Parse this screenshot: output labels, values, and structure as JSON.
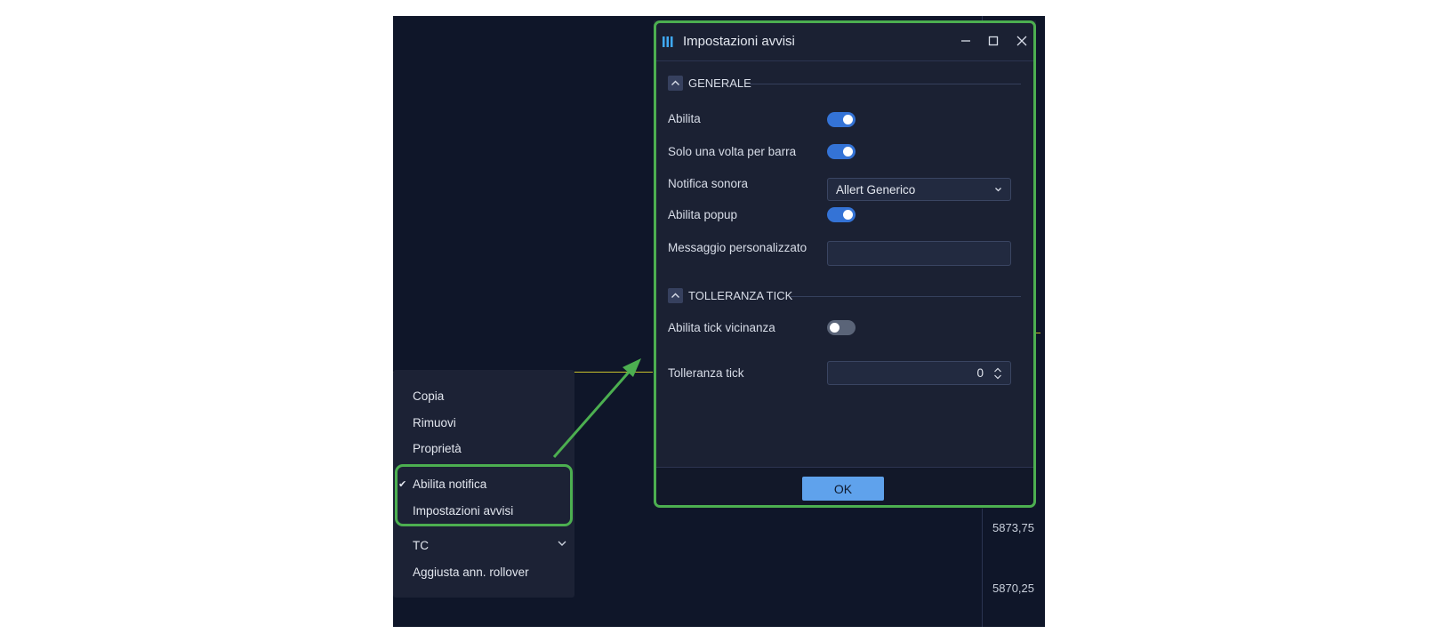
{
  "chart": {
    "price_labels": [
      "5873,75",
      "5870,25"
    ]
  },
  "context_menu": {
    "items": [
      "Copia",
      "Rimuovi",
      "Proprietà"
    ],
    "notify_toggle": {
      "label": "Abilita notifica",
      "check": "✔"
    },
    "alert_settings": "Impostazioni avvisi",
    "tc": "TC",
    "rollover": "Aggiusta ann. rollover"
  },
  "dialog": {
    "title": "Impostazioni avvisi",
    "sections": {
      "general": {
        "title": "GENERALE",
        "enable": {
          "label": "Abilita",
          "on": true
        },
        "once_per_bar": {
          "label": "Solo una volta per barra",
          "on": true
        },
        "sound": {
          "label": "Notifica sonora",
          "value": "Allert Generico"
        },
        "popup": {
          "label": "Abilita popup",
          "on": true
        },
        "custom_message": {
          "label": "Messaggio personalizzato",
          "value": ""
        }
      },
      "tick": {
        "title": "TOLLERANZA TICK",
        "proximity": {
          "label": "Abilita tick vicinanza",
          "on": false
        },
        "tolerance": {
          "label": "Tolleranza tick",
          "value": "0"
        }
      }
    },
    "ok_label": "OK"
  },
  "colors": {
    "highlight": "#4caf50",
    "toggle_on": "#3473d6",
    "ok_button": "#5fa2ec",
    "chart_bg": "#0f1629"
  },
  "icons": [
    "app-logo-icon",
    "minimize-icon",
    "maximize-icon",
    "close-icon",
    "collapse-icon",
    "chevron-down-icon",
    "spinner-arrows-icon",
    "checkmark-icon",
    "arrow-pointer"
  ]
}
